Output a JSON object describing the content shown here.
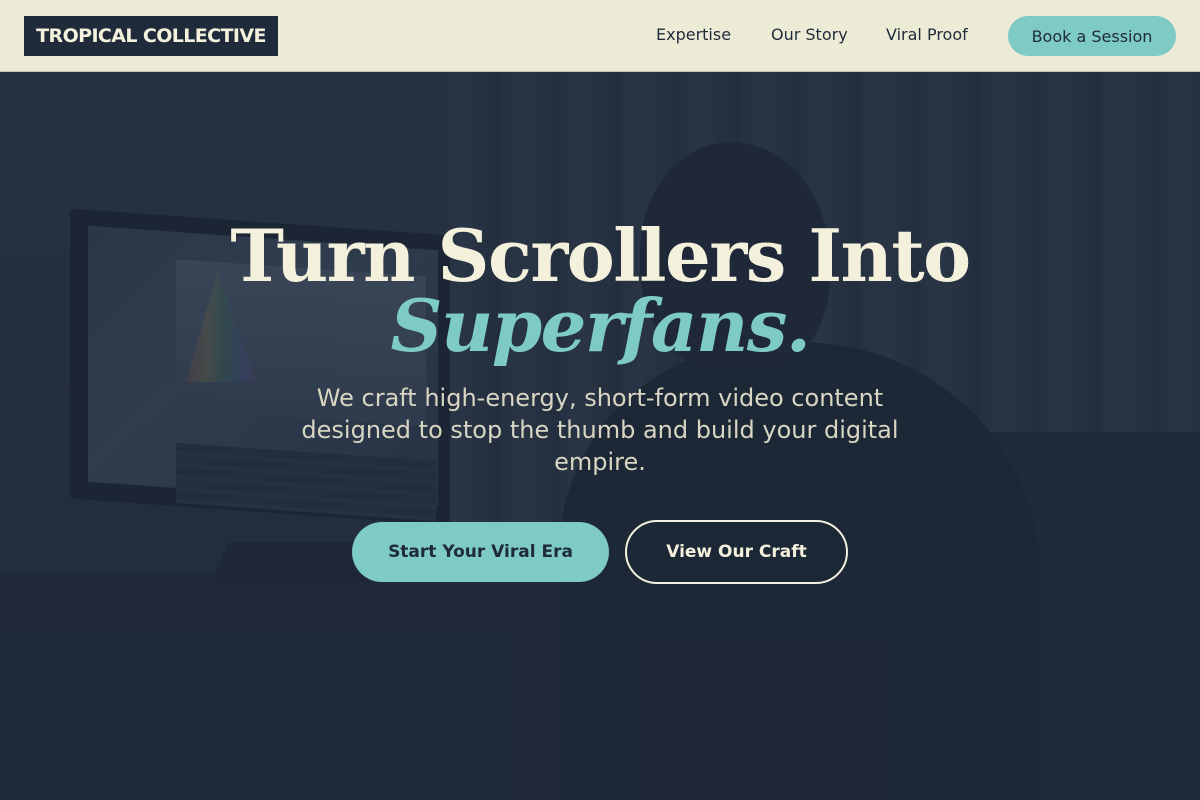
{
  "header": {
    "logo_text": "TROPICAL COLLECTIVE",
    "nav": [
      {
        "label": "Expertise"
      },
      {
        "label": "Our Story"
      },
      {
        "label": "Viral Proof"
      }
    ],
    "cta_label": "Book a Session"
  },
  "hero": {
    "headline_line1": "Turn Scrollers Into",
    "headline_line2": "Superfans.",
    "subtext": "We craft high-energy, short-form video content designed to stop the thumb and build your digital empire.",
    "primary_button": "Start Your Viral Era",
    "secondary_button": "View Our Craft",
    "background_image": "person editing video at a desktop monitor in a dark room"
  },
  "colors": {
    "navy": "#1f2a3a",
    "cream": "#ecebd6",
    "teal_accent": "#7ecac4",
    "headline_cream": "#f3f0dc"
  }
}
